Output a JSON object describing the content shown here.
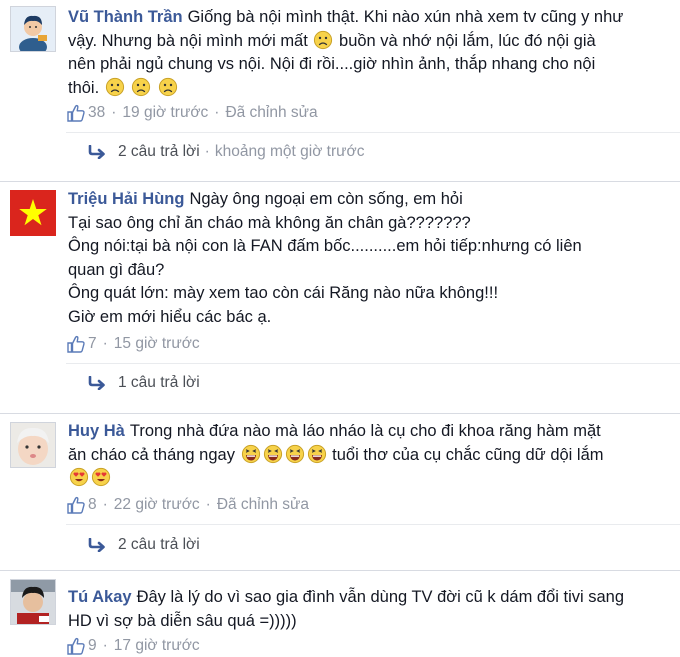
{
  "comments": [
    {
      "author": "Vũ Thành Trần",
      "lines": [
        "Giống bà nội mình thật. Khi nào xún nhà xem tv cũng y như",
        "vậy. Nhưng bà nội mình mới mất",
        "buồn và nhớ nội lắm, lúc đó nội già",
        "nên phải ngủ chung vs nội. Nội đi rồi....giờ nhìn ảnh, thắp nhang cho nội",
        "thôi."
      ],
      "likes": "38",
      "time": "19 giờ trước",
      "edited": "Đã chỉnh sửa",
      "replies": "2 câu trả lời",
      "reply_time": "khoảng một giờ trước"
    },
    {
      "author": "Triệu Hải Hùng",
      "lines": [
        "Ngày ông ngoại em còn sống, em hỏi",
        "Tại sao ông chỉ ăn cháo mà không ăn chân gà???????",
        "Ông nói:tại bà nội con là FAN đấm bốc..........em hỏi tiếp:nhưng có liên",
        "quan gì đâu?",
        "Ông quát lớn: mày xem tao còn cái Răng nào nữa không!!!",
        "Giờ em mới hiểu các bác ạ."
      ],
      "likes": "7",
      "time": "15 giờ trước",
      "replies": "1 câu trả lời"
    },
    {
      "author": "Huy Hà",
      "lines": [
        "Trong nhà đứa nào mà láo nháo là cụ cho đi khoa răng hàm mặt",
        "ăn cháo cả tháng ngay",
        "tuổi thơ của cụ chắc cũng dữ dội lắm"
      ],
      "likes": "8",
      "time": "22 giờ trước",
      "edited": "Đã chỉnh sửa",
      "replies": "2 câu trả lời"
    },
    {
      "author": "Tú Akay",
      "lines": [
        "Đây là lý do vì sao gia đình vẫn dùng TV đời cũ k dám đổi tivi sang",
        "HD vì sợ bà diễn sâu quá =)))))"
      ],
      "likes": "9",
      "time": "17 giờ trước"
    }
  ],
  "icons": {
    "like": "thumbs-up-icon",
    "reply": "reply-arrow-icon",
    "sad": "sad-face-emoji",
    "laugh": "laughing-emoji",
    "heart_eyes": "heart-eyes-emoji",
    "flag": "vietnam-flag-avatar"
  },
  "colors": {
    "author": "#3b5998",
    "meta": "#9197a3",
    "divider": "#d8dbe2",
    "flag_red": "#da251d",
    "flag_star": "#ffff00"
  }
}
